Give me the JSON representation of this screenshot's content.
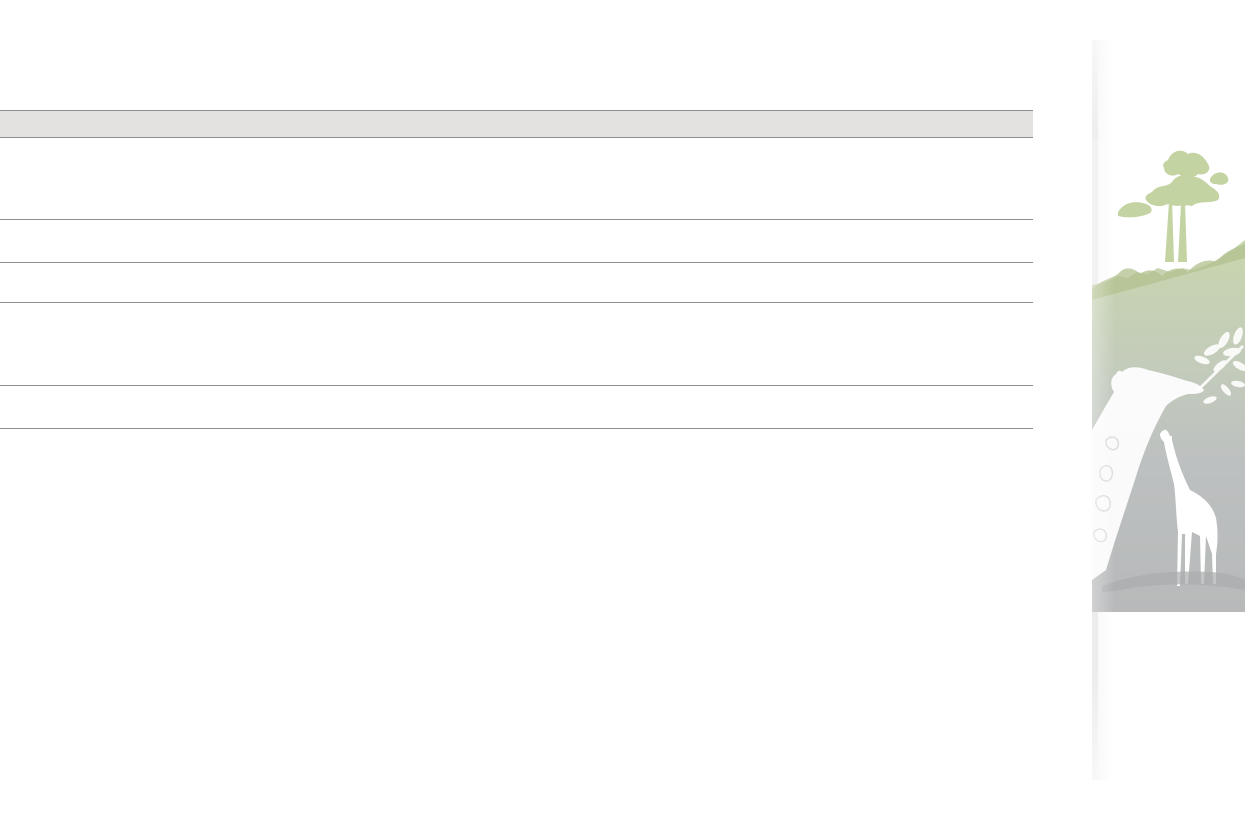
{
  "table": {
    "header": "",
    "rows": [
      {
        "text": ""
      },
      {
        "text": ""
      },
      {
        "text": ""
      },
      {
        "text": ""
      },
      {
        "text": ""
      }
    ]
  },
  "side_art": {
    "icon": "savanna-giraffe-illustration",
    "colors": {
      "foliage": "#c5d5a6",
      "foliage_dark": "#aebf8a",
      "panel": "#b9bcbd",
      "silhouette": "#ffffff"
    }
  }
}
